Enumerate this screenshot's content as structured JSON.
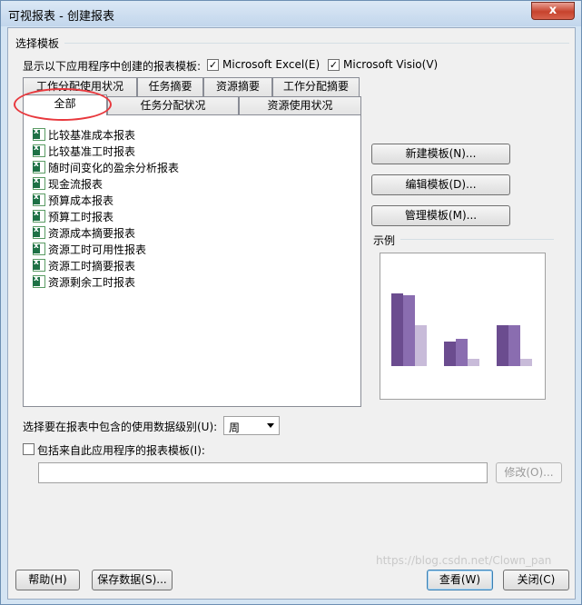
{
  "window": {
    "title": "可视报表 - 创建报表",
    "close_glyph": "x"
  },
  "section_title": "选择模板",
  "app_filter": {
    "label": "显示以下应用程序中创建的报表模板:",
    "excel": {
      "label": "Microsoft Excel(E)",
      "checked": true,
      "mark": "✓"
    },
    "visio": {
      "label": "Microsoft Visio(V)",
      "checked": true,
      "mark": "✓"
    }
  },
  "tabs": {
    "back_row": [
      "工作分配使用状况",
      "任务摘要",
      "资源摘要",
      "工作分配摘要"
    ],
    "front_row": [
      "全部",
      "任务分配状况",
      "资源使用状况"
    ],
    "active": "全部"
  },
  "templates": [
    "比较基准成本报表",
    "比较基准工时报表",
    "随时间变化的盈余分析报表",
    "现金流报表",
    "预算成本报表",
    "预算工时报表",
    "资源成本摘要报表",
    "资源工时可用性报表",
    "资源工时摘要报表",
    "资源剩余工时报表"
  ],
  "side_buttons": {
    "new": "新建模板(N)...",
    "edit": "编辑模板(D)...",
    "manage": "管理模板(M)..."
  },
  "sample_label": "示例",
  "sample_chart": {
    "groups": [
      [
        80,
        78,
        45
      ],
      [
        27,
        30,
        8
      ],
      [
        45,
        45,
        8
      ]
    ],
    "colors": [
      "#6b4c8f",
      "#8a6db0",
      "#c8bbd9"
    ]
  },
  "usage_level": {
    "label": "选择要在报表中包含的使用数据级别(U):",
    "value": "周"
  },
  "include_templates": {
    "label": "包括来自此应用程序的报表模板(I):",
    "checked": false,
    "path_value": "",
    "modify_button": "修改(O)..."
  },
  "footer": {
    "help": "帮助(H)",
    "save_data": "保存数据(S)...",
    "view": "查看(W)",
    "close": "关闭(C)"
  },
  "watermark": "https://blog.csdn.net/Clown_pan"
}
